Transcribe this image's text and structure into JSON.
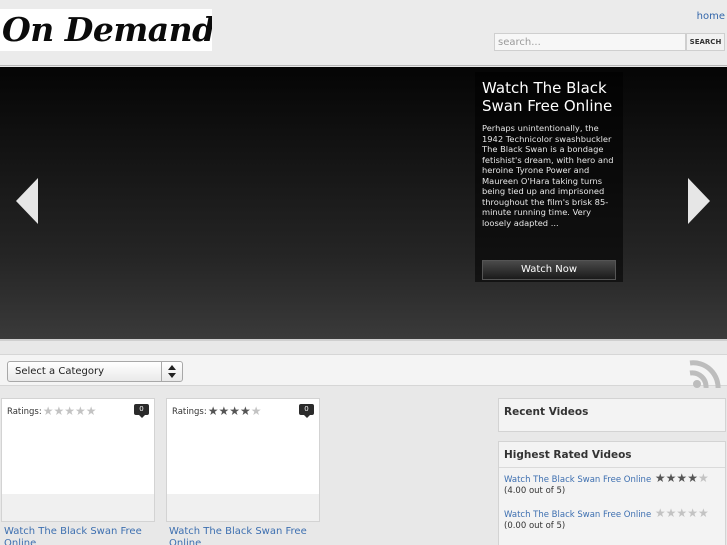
{
  "header": {
    "logo_text": "On Demand",
    "home_label": "home",
    "search_placeholder": "search...",
    "search_button": "SEARCH"
  },
  "hero": {
    "title": "Watch The Black Swan Free Online",
    "description": "Perhaps unintentionally, the 1942 Technicolor swashbuckler The Black Swan is a bondage fetishist's dream, with hero and heroine Tyrone Power and Maureen O'Hara taking turns being tied up and imprisoned throughout the film's brisk 85-minute running time. Very loosely adapted ...",
    "button_label": "Watch Now"
  },
  "category": {
    "selected": "Select a Category"
  },
  "cards": [
    {
      "ratings_label": "Ratings:",
      "rating": 0,
      "max_rating": 5,
      "comments": "0",
      "title": "Watch The Black Swan Free Online"
    },
    {
      "ratings_label": "Ratings:",
      "rating": 4,
      "max_rating": 5,
      "comments": "0",
      "title": "Watch The Black Swan Free Online"
    }
  ],
  "sidebar": {
    "recent_title": "Recent Videos",
    "rated_title": "Highest Rated Videos",
    "rated_items": [
      {
        "title": "Watch The Black Swan Free Online",
        "rating": 4,
        "max_rating": 5,
        "score": "(4.00 out of 5)"
      },
      {
        "title": "Watch The Black Swan Free Online",
        "rating": 0,
        "max_rating": 5,
        "score": "(0.00 out of 5)"
      }
    ]
  },
  "colors": {
    "link": "#3d6fb0",
    "star_on": "#555555",
    "star_off": "#c3c3c3"
  }
}
